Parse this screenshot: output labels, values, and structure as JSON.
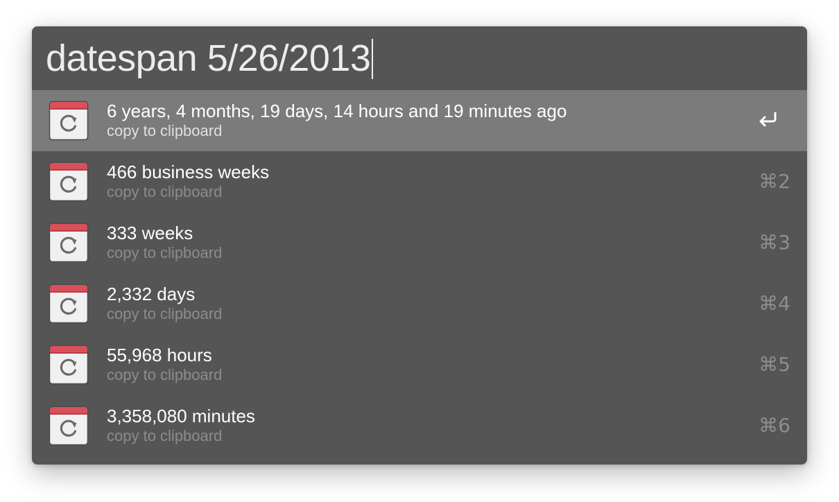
{
  "search": {
    "query": "datespan 5/26/2013"
  },
  "icons": {
    "result_icon": "calendar-refresh-icon",
    "enter_icon": "return-key-icon"
  },
  "colors": {
    "window_bg": "#555555",
    "selected_row_bg": "#7b7b7b",
    "calendar_header": "#d9505a"
  },
  "results": [
    {
      "title": "6 years, 4 months, 19 days, 14 hours and 19 minutes ago",
      "subtitle": "copy to clipboard",
      "shortcut": ""
    },
    {
      "title": "466 business weeks",
      "subtitle": "copy to clipboard",
      "shortcut": "⌘2"
    },
    {
      "title": "333 weeks",
      "subtitle": "copy to clipboard",
      "shortcut": "⌘3"
    },
    {
      "title": "2,332 days",
      "subtitle": "copy to clipboard",
      "shortcut": "⌘4"
    },
    {
      "title": "55,968 hours",
      "subtitle": "copy to clipboard",
      "shortcut": "⌘5"
    },
    {
      "title": "3,358,080 minutes",
      "subtitle": "copy to clipboard",
      "shortcut": "⌘6"
    }
  ]
}
